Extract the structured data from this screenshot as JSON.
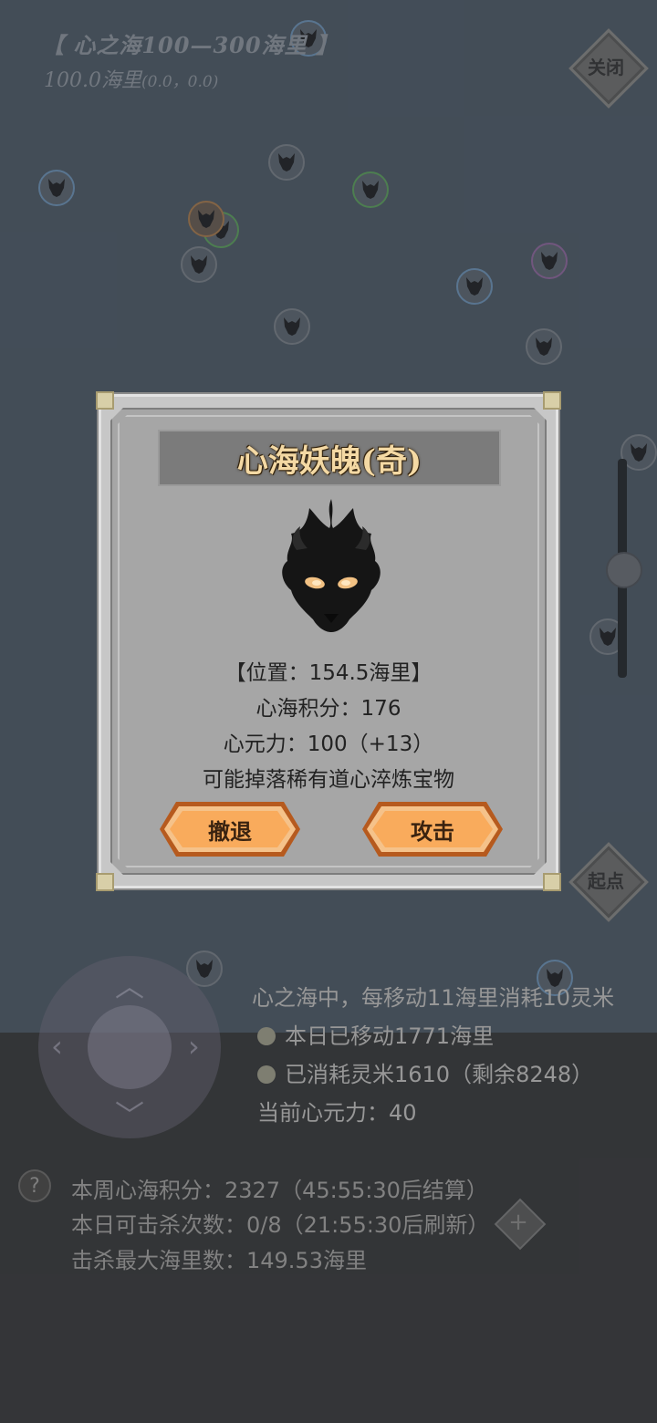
{
  "header": {
    "region": "【 心之海100—300海里 】",
    "distance": "100.0海里",
    "coords": "(0.0，0.0)"
  },
  "buttons": {
    "close": "关闭",
    "start_point": "起点",
    "plus": "+"
  },
  "dialog": {
    "title": "心海妖魄(奇)",
    "position": "【位置：154.5海里】",
    "score": "心海积分：176",
    "power": "心元力：100（+13）",
    "drop": "可能掉落稀有道心淬炼宝物",
    "retreat_label": "撤退",
    "attack_label": "攻击"
  },
  "status": {
    "cost_rule": "心之海中，每移动11海里消耗10灵米",
    "moved_today": "本日已移动1771海里",
    "consumed": "已消耗灵米1610（剩余8248）",
    "current_power": "当前心元力：40"
  },
  "footer": {
    "help": "?",
    "weekly_score": "本周心海积分：2327（45:55:30后结算）",
    "kills_today": "本日可击杀次数：0/8（21:55:30后刷新）",
    "max_kill_distance": "击杀最大海里数：149.53海里"
  },
  "icons": {
    "monster": "wolf-spirit-icon",
    "joystick": "dpad-arrows"
  },
  "colors": {
    "sea": "#525e6b",
    "button_orange": "#f9ab5c",
    "title_gold": "#f4d9a4"
  }
}
